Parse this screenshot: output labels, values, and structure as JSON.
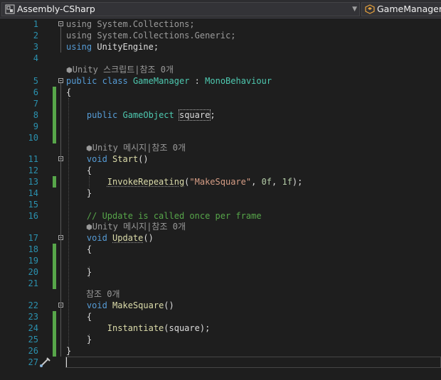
{
  "toolbar": {
    "project_selector": "Assembly-CSharp",
    "project_icon": "csharp-project-icon",
    "class_selector": "GameManager",
    "class_icon": "class-icon"
  },
  "line_numbers": [
    "1",
    "2",
    "3",
    "4",
    "5",
    "6",
    "7",
    "8",
    "9",
    "10",
    "11",
    "12",
    "13",
    "14",
    "15",
    "16",
    "17",
    "18",
    "19",
    "20",
    "21",
    "22",
    "23",
    "24",
    "25",
    "26",
    "27"
  ],
  "code": {
    "l1": {
      "kw": "using",
      "rest": " System.Collections;"
    },
    "l2": {
      "kw": "using",
      "rest": " System.Collections.Generic;"
    },
    "l3": {
      "kw": "using",
      "rest": " UnityEngine;"
    },
    "lens_class": "Unity 스크립트|참조 0개",
    "l5": {
      "kw1": "public",
      "kw2": "class",
      "name": "GameManager",
      "colon": ":",
      "base": "MonoBehaviour"
    },
    "l6": "{",
    "l8": {
      "kw": "public",
      "type": "GameObject",
      "field": "square",
      "semi": ";"
    },
    "lens_start": "Unity 메시지|참조 0개",
    "l11": {
      "kw": "void",
      "name": "Start",
      "paren": "()"
    },
    "l12": "{",
    "l13": {
      "fn": "InvokeRepeating",
      "open": "(",
      "str": "\"MakeSquare\"",
      "c1": ", ",
      "n1": "0f",
      "c2": ", ",
      "n2": "1f",
      "close": ");"
    },
    "l14": "}",
    "l16": "// Update is called once per frame",
    "lens_update": "Unity 메시지|참조 0개",
    "l17": {
      "kw": "void",
      "name": "Update",
      "paren": "()"
    },
    "l18": "{",
    "l20": "}",
    "lens_make": "참조 0개",
    "l22": {
      "kw": "void",
      "name": "MakeSquare",
      "paren": "()"
    },
    "l23": "{",
    "l24": {
      "fn": "Instantiate",
      "args": "(square);"
    },
    "l25": "}",
    "l26": "}"
  }
}
